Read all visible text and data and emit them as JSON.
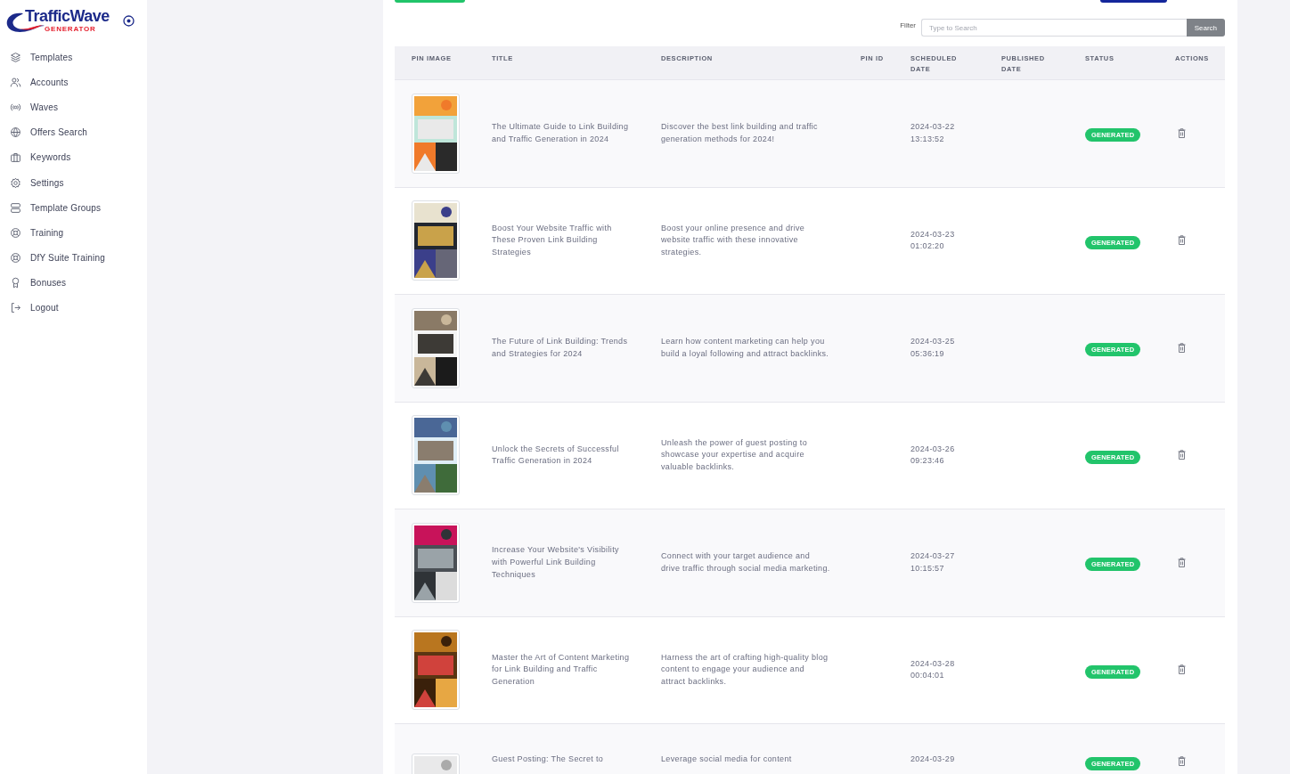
{
  "brand": {
    "name": "TrafficWave",
    "tagline": "GENERATOR"
  },
  "sidebar": {
    "items": [
      {
        "label": "Templates"
      },
      {
        "label": "Accounts"
      },
      {
        "label": "Waves"
      },
      {
        "label": "Offers Search"
      },
      {
        "label": "Keywords"
      },
      {
        "label": "Settings"
      },
      {
        "label": "Template Groups"
      },
      {
        "label": "Training"
      },
      {
        "label": "DfY Suite Training"
      },
      {
        "label": "Bonuses"
      },
      {
        "label": "Logout"
      }
    ]
  },
  "filter": {
    "label": "Filter",
    "placeholder": "Type to Search",
    "button": "Search"
  },
  "table": {
    "columns": [
      "PIN IMAGE",
      "TITLE",
      "DESCRIPTION",
      "PIN ID",
      "SCHEDULED DATE",
      "PUBLISHED DATE",
      "STATUS",
      "ACTIONS"
    ],
    "rows": [
      {
        "title": "The Ultimate Guide to Link Building and Traffic Generation in 2024",
        "description": "Discover the best link building and traffic generation methods for 2024!",
        "scheduled_date": "2024-03-22 13:13:52",
        "status": "GENERATED"
      },
      {
        "title": "Boost Your Website Traffic with These Proven Link Building Strategies",
        "description": "Boost your online presence and drive website traffic with these innovative strategies.",
        "scheduled_date": "2024-03-23 01:02:20",
        "status": "GENERATED"
      },
      {
        "title": "The Future of Link Building: Trends and Strategies for 2024",
        "description": "Learn how content marketing can help you build a loyal following and attract backlinks.",
        "scheduled_date": "2024-03-25 05:36:19",
        "status": "GENERATED"
      },
      {
        "title": "Unlock the Secrets of Successful Traffic Generation in 2024",
        "description": "Unleash the power of guest posting to showcase your expertise and acquire valuable backlinks.",
        "scheduled_date": "2024-03-26 09:23:46",
        "status": "GENERATED"
      },
      {
        "title": "Increase Your Website's Visibility with Powerful Link Building Techniques",
        "description": "Connect with your target audience and drive traffic through social media marketing.",
        "scheduled_date": "2024-03-27 10:15:57",
        "status": "GENERATED"
      },
      {
        "title": "Master the Art of Content Marketing for Link Building and Traffic Generation",
        "description": "Harness the art of crafting high-quality blog content to engage your audience and attract backlinks.",
        "scheduled_date": "2024-03-28 00:04:01",
        "status": "GENERATED"
      },
      {
        "title": "Guest Posting: The Secret to",
        "description": "Leverage social media for content",
        "scheduled_date": "2024-03-29",
        "status": "GENERATED"
      }
    ]
  }
}
